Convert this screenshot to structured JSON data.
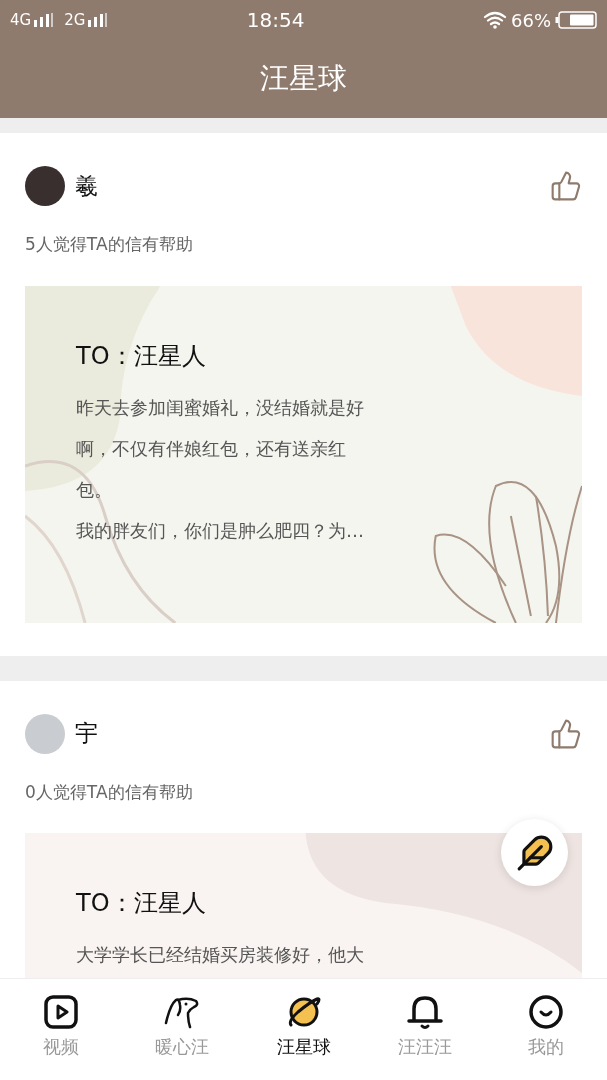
{
  "status_bar": {
    "carrier_1": "4G",
    "carrier_2": "2G",
    "time": "18:54",
    "battery": "66%"
  },
  "header": {
    "title": "汪星球"
  },
  "letters": [
    {
      "user": "羲",
      "helpful": "5人觉得TA的信有帮助",
      "to": "TO：汪星人",
      "kind": "floral",
      "lines": [
        "昨天去参加闺蜜婚礼，没结婚就是好",
        "啊，不仅有伴娘红包，还有送亲红",
        "包。",
        "我的胖友们，你们是肿么肥四？为…"
      ]
    },
    {
      "user": "宇",
      "helpful": "0人觉得TA的信有帮助",
      "to": "TO：汪星人",
      "kind": "blush",
      "lines": [
        "大学学长已经结婚买房装修好，他大"
      ]
    }
  ],
  "tabs": [
    {
      "label": "视频",
      "kind": "video",
      "selected": false
    },
    {
      "label": "暖心汪",
      "kind": "dog",
      "selected": false
    },
    {
      "label": "汪星球",
      "kind": "planet",
      "selected": true
    },
    {
      "label": "汪汪汪",
      "kind": "bell",
      "selected": false
    },
    {
      "label": "我的",
      "kind": "smile",
      "selected": false
    }
  ]
}
